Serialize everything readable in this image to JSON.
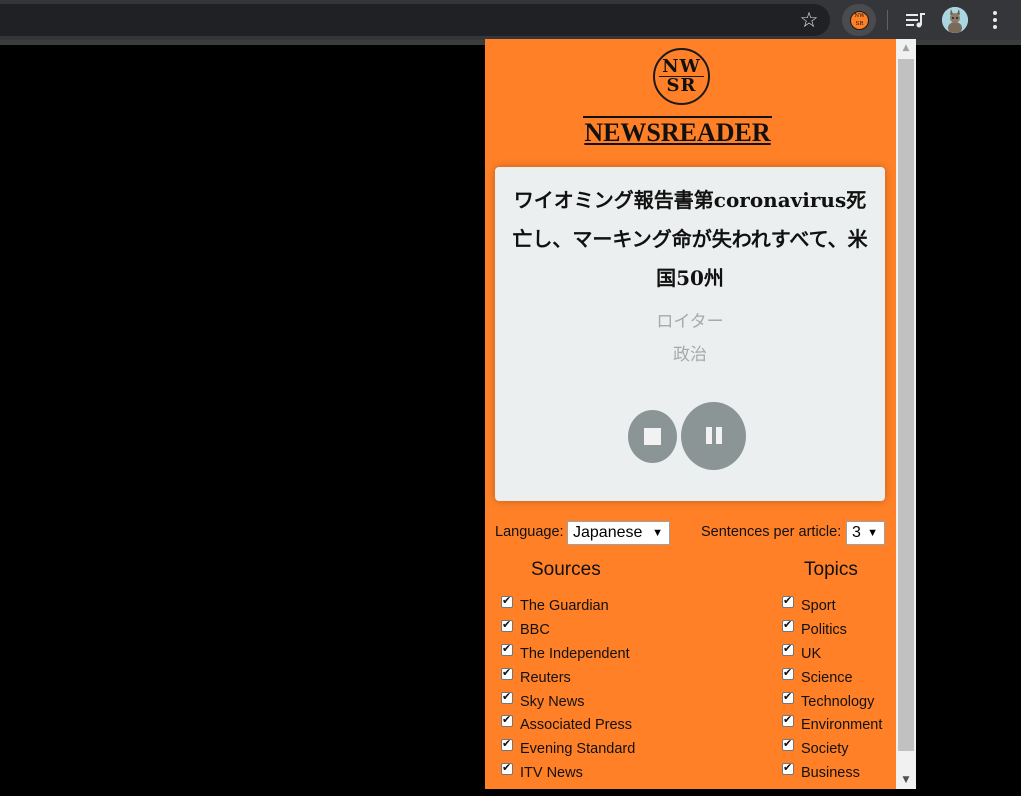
{
  "popup": {
    "logo_line1": "NW",
    "logo_line2": "SR",
    "brand_title": "NEWSREADER",
    "article": {
      "headline": "ワイオミング報告書第coronavirus死亡し、マーキング命が失われすべて、米国50州",
      "source": "ロイター",
      "category": "政治"
    },
    "settings": {
      "language_label": "Language:",
      "language_value": "Japanese",
      "sentences_label": "Sentences per article:",
      "sentences_value": "3"
    },
    "sources_heading": "Sources",
    "topics_heading": "Topics",
    "sources": [
      "The Guardian",
      "BBC",
      "The Independent",
      "Reuters",
      "Sky News",
      "Associated Press",
      "Evening Standard",
      "ITV News"
    ],
    "topics": [
      "Sport",
      "Politics",
      "UK",
      "Science",
      "Technology",
      "Environment",
      "Society",
      "Business"
    ]
  },
  "icons": {
    "bookmark": "star-icon",
    "extension": "newsreader-extension-icon",
    "media": "media-controls-icon",
    "profile": "avatar",
    "menu": "more-vert-icon"
  },
  "colors": {
    "popup_bg": "#ff8027",
    "card_bg": "#ecefef",
    "button_gray": "#8c9595",
    "muted_text": "#a8aaaa"
  }
}
